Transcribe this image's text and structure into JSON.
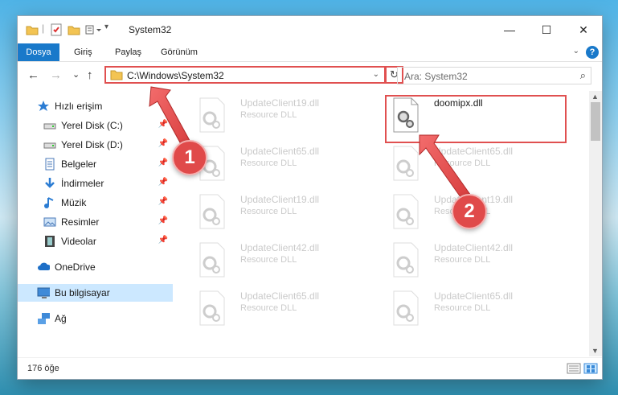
{
  "window": {
    "title": "System32",
    "minimize_label": "—",
    "maximize_label": "☐",
    "close_label": "✕"
  },
  "ribbon": {
    "tabs": [
      "Dosya",
      "Giriş",
      "Paylaş",
      "Görünüm"
    ],
    "help": "?"
  },
  "navbar": {
    "back": "←",
    "forward": "→",
    "recent": "⌄",
    "up": "↑",
    "address": "C:\\Windows\\System32",
    "refresh": "↻",
    "search_placeholder": "Ara: System32"
  },
  "sidebar": {
    "items": [
      {
        "label": "Hızlı erişim",
        "icon": "star-icon",
        "pinned": false
      },
      {
        "label": "Yerel Disk (C:)",
        "icon": "drive-icon",
        "pinned": true
      },
      {
        "label": "Yerel Disk (D:)",
        "icon": "drive-icon",
        "pinned": true
      },
      {
        "label": "Belgeler",
        "icon": "document-icon",
        "pinned": true
      },
      {
        "label": "İndirmeler",
        "icon": "download-icon",
        "pinned": true
      },
      {
        "label": "Müzik",
        "icon": "music-icon",
        "pinned": true
      },
      {
        "label": "Resimler",
        "icon": "picture-icon",
        "pinned": true
      },
      {
        "label": "Videolar",
        "icon": "video-icon",
        "pinned": true
      },
      {
        "label": "OneDrive",
        "icon": "cloud-icon",
        "pinned": false
      },
      {
        "label": "Bu bilgisayar",
        "icon": "computer-icon",
        "pinned": false,
        "selected": true
      },
      {
        "label": "Ağ",
        "icon": "network-icon",
        "pinned": false
      }
    ]
  },
  "files": [
    {
      "name": "UpdateClient19.dll",
      "type": "Resource DLL"
    },
    {
      "name": "doomipx.dll",
      "type": ""
    },
    {
      "name": "UpdateClient65.dll",
      "type": "Resource DLL"
    },
    {
      "name": "UpdateClient65.dll",
      "type": "Resource DLL"
    },
    {
      "name": "UpdateClient19.dll",
      "type": "Resource DLL"
    },
    {
      "name": "UpdateClient19.dll",
      "type": "Resource DLL"
    },
    {
      "name": "UpdateClient42.dll",
      "type": "Resource DLL"
    },
    {
      "name": "UpdateClient42.dll",
      "type": "Resource DLL"
    },
    {
      "name": "UpdateClient65.dll",
      "type": "Resource DLL"
    },
    {
      "name": "UpdateClient65.dll",
      "type": "Resource DLL"
    }
  ],
  "status": {
    "count": "176 öğe"
  },
  "annotations": {
    "step1": "1",
    "step2": "2"
  },
  "colors": {
    "accent": "#1979ca",
    "highlight": "#e05050",
    "selected": "#cce8ff"
  }
}
